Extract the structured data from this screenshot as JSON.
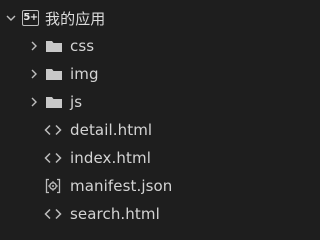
{
  "project": {
    "name": "我的应用",
    "badge_text": "5+",
    "expanded": true,
    "icon": "uniapp-project-icon"
  },
  "folders": [
    {
      "name": "css",
      "icon": "folder-icon",
      "expanded": false
    },
    {
      "name": "img",
      "icon": "folder-icon",
      "expanded": false
    },
    {
      "name": "js",
      "icon": "folder-icon",
      "expanded": false
    }
  ],
  "files": [
    {
      "name": "detail.html",
      "icon": "code-icon"
    },
    {
      "name": "index.html",
      "icon": "code-icon"
    },
    {
      "name": "manifest.json",
      "icon": "gear-file-icon"
    },
    {
      "name": "search.html",
      "icon": "code-icon"
    }
  ],
  "colors": {
    "background": "#1e1e1e",
    "text": "#d4d4d4",
    "icon": "#bdbdbd"
  }
}
